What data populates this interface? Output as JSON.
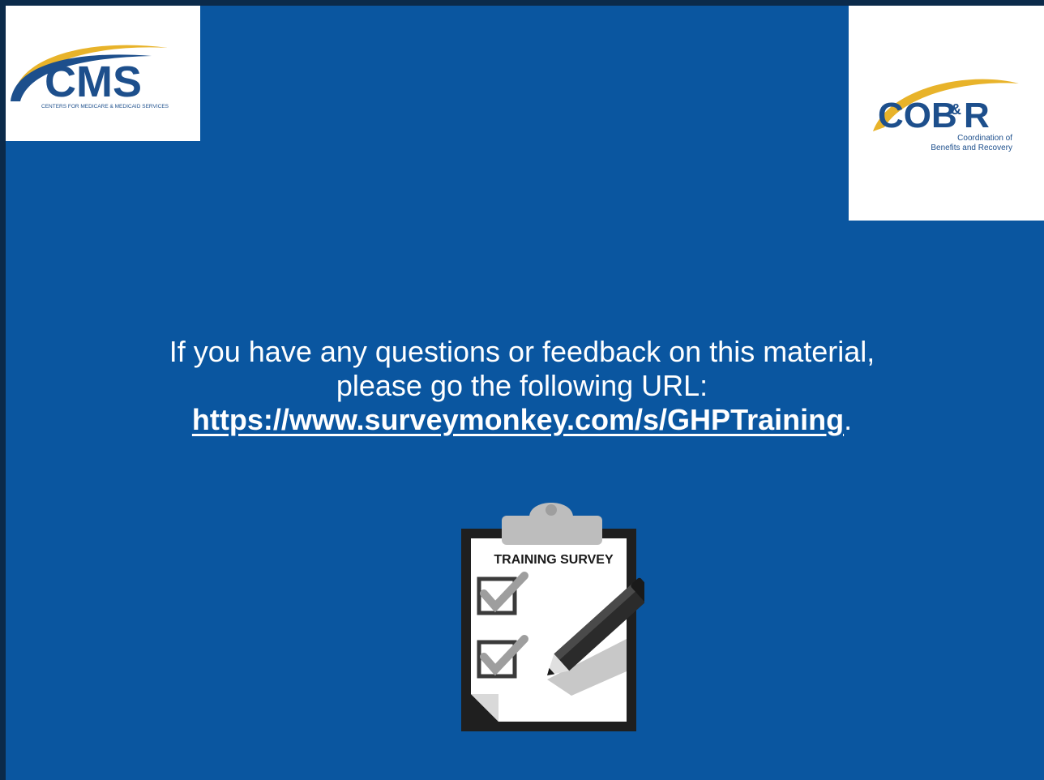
{
  "logos": {
    "cms": {
      "wordmark": "CMS",
      "tagline": "CENTERS FOR MEDICARE & MEDICAID SERVICES"
    },
    "cobr": {
      "wordmark_cob": "COB",
      "wordmark_amp": "&",
      "wordmark_r": "R",
      "tagline_line1": "Coordination of",
      "tagline_line2": "Benefits and Recovery"
    }
  },
  "message": {
    "line1": "If you have any questions or feedback on this material,",
    "line2": "please go the following URL:",
    "url": "https://www.surveymonkey.com/s/GHPTraining",
    "url_suffix": "."
  },
  "clipboard": {
    "title": "TRAINING SURVEY",
    "icon": "clipboard-checklist-icon"
  },
  "colors": {
    "background": "#0a56a0",
    "text": "#ffffff",
    "cms_blue": "#1d4f8c",
    "cms_gold": "#e8b32a"
  }
}
